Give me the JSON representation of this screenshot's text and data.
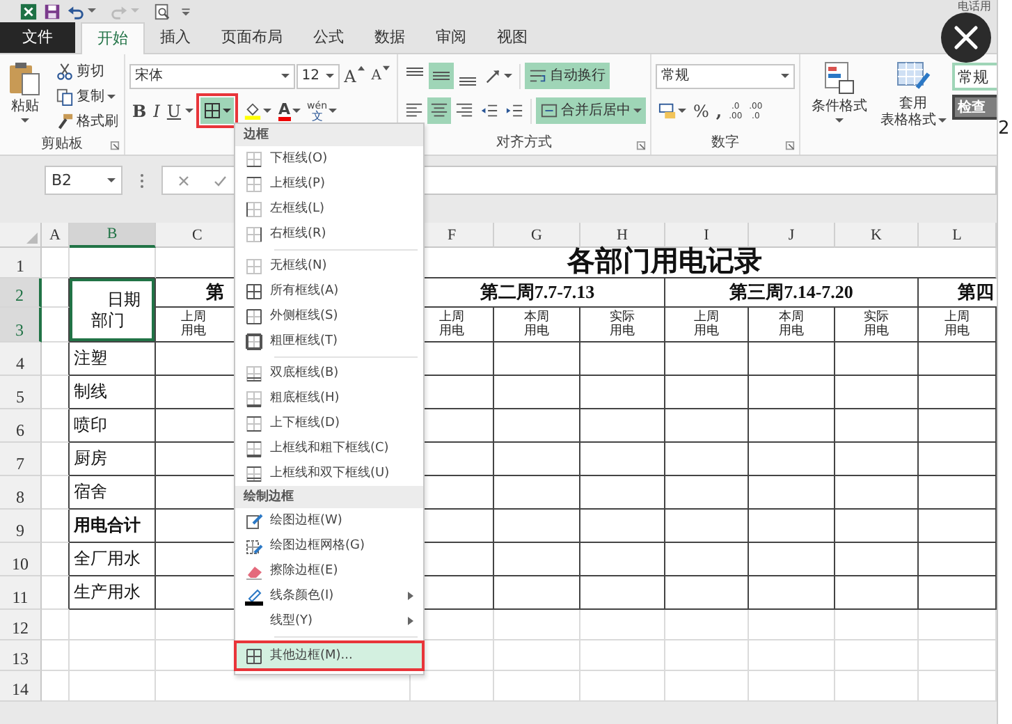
{
  "title_bar": {
    "text": "电话用"
  },
  "tabs": [
    {
      "label": "文件",
      "kind": "file",
      "selected": false
    },
    {
      "label": "开始",
      "kind": "tab",
      "selected": true
    },
    {
      "label": "插入",
      "kind": "tab",
      "selected": false
    },
    {
      "label": "页面布局",
      "kind": "tab",
      "selected": false
    },
    {
      "label": "公式",
      "kind": "tab",
      "selected": false
    },
    {
      "label": "数据",
      "kind": "tab",
      "selected": false
    },
    {
      "label": "审阅",
      "kind": "tab",
      "selected": false
    },
    {
      "label": "视图",
      "kind": "tab",
      "selected": false
    }
  ],
  "ribbon": {
    "clipboard": {
      "label": "剪贴板",
      "paste": "粘贴",
      "cut": "剪切",
      "copy": "复制",
      "format_painter": "格式刷"
    },
    "font": {
      "name": "宋体",
      "size": "12",
      "grow": "A",
      "shrink": "A",
      "bold": "B",
      "italic": "I",
      "underline": "U",
      "font_color": "A",
      "phonetic": [
        "wén",
        "文"
      ],
      "borders_annotated": true
    },
    "alignment": {
      "label": "对齐方式",
      "align_buttons": [
        {
          "selected": false
        },
        {
          "selected": true
        },
        {
          "selected": false
        },
        {
          "selected": false
        },
        {
          "selected": true
        },
        {
          "selected": false
        }
      ],
      "wrap_text": {
        "label": "自动换行",
        "on": true
      },
      "merge_center": {
        "label": "合并后居中",
        "on": true
      }
    },
    "number": {
      "label": "数字",
      "format": "常规",
      "percent": "%",
      "comma": ",",
      "increase_decimal": [
        ".0",
        ".00"
      ],
      "decrease_decimal": [
        ".00",
        ".0"
      ]
    },
    "styles": {
      "conditional": "条件格式",
      "table_format": [
        "套用",
        "表格格式"
      ],
      "cell_styles": [
        {
          "label": "常规",
          "kind": "normal"
        },
        {
          "label": "检查",
          "kind": "check"
        }
      ]
    }
  },
  "formula_bar": {
    "name_box": "B2"
  },
  "sheet": {
    "columns": [
      {
        "label": "A",
        "selected": false
      },
      {
        "label": "B",
        "selected": true
      },
      {
        "label": "C",
        "selected": false
      },
      {
        "label": "F",
        "selected": false
      },
      {
        "label": "G",
        "selected": false
      },
      {
        "label": "H",
        "selected": false
      },
      {
        "label": "I",
        "selected": false
      },
      {
        "label": "J",
        "selected": false
      },
      {
        "label": "K",
        "selected": false
      },
      {
        "label": "L",
        "selected": false
      }
    ],
    "rows": [
      {
        "label": "1",
        "selected": false
      },
      {
        "label": "2",
        "selected": true
      },
      {
        "label": "3",
        "selected": true
      },
      {
        "label": "4",
        "selected": false
      },
      {
        "label": "5",
        "selected": false
      },
      {
        "label": "6",
        "selected": false
      },
      {
        "label": "7",
        "selected": false
      },
      {
        "label": "8",
        "selected": false
      },
      {
        "label": "9",
        "selected": false
      },
      {
        "label": "10",
        "selected": false
      },
      {
        "label": "11",
        "selected": false
      },
      {
        "label": "12",
        "selected": false
      },
      {
        "label": "13",
        "selected": false
      },
      {
        "label": "14",
        "selected": false
      }
    ],
    "title": "各部门用电记录",
    "corner_header": {
      "top": "日期",
      "bottom": "部门",
      "selected": true
    },
    "week_headers": [
      "第",
      "第二周7.7-7.13",
      "第三周7.14-7.20",
      "第四"
    ],
    "sub_headers": [
      "上周用电",
      "上周用电",
      "本周用电",
      "实际用电",
      "上周用电",
      "本周用电",
      "实际用电",
      "上周用电"
    ],
    "departments": [
      {
        "label": "注塑",
        "bold": false
      },
      {
        "label": "制线",
        "bold": false
      },
      {
        "label": "喷印",
        "bold": false
      },
      {
        "label": "厨房",
        "bold": false
      },
      {
        "label": "宿舍",
        "bold": false
      },
      {
        "label": "用电合计",
        "bold": true
      },
      {
        "label": "全厂用水",
        "bold": false
      },
      {
        "label": "生产用水",
        "bold": false
      }
    ]
  },
  "menu": {
    "sections": [
      {
        "header": "边框",
        "groups": [
          [
            {
              "label": "下框线(O)",
              "submenu": false,
              "selected": false,
              "annotated": false
            },
            {
              "label": "上框线(P)",
              "submenu": false,
              "selected": false,
              "annotated": false
            },
            {
              "label": "左框线(L)",
              "submenu": false,
              "selected": false,
              "annotated": false
            },
            {
              "label": "右框线(R)",
              "submenu": false,
              "selected": false,
              "annotated": false
            }
          ],
          [
            {
              "label": "无框线(N)",
              "submenu": false,
              "selected": false,
              "annotated": false
            },
            {
              "label": "所有框线(A)",
              "submenu": false,
              "selected": false,
              "annotated": false
            },
            {
              "label": "外侧框线(S)",
              "submenu": false,
              "selected": false,
              "annotated": false
            },
            {
              "label": "粗匣框线(T)",
              "submenu": false,
              "selected": false,
              "annotated": false
            }
          ],
          [
            {
              "label": "双底框线(B)",
              "submenu": false,
              "selected": false,
              "annotated": false
            },
            {
              "label": "粗底框线(H)",
              "submenu": false,
              "selected": false,
              "annotated": false
            },
            {
              "label": "上下框线(D)",
              "submenu": false,
              "selected": false,
              "annotated": false
            },
            {
              "label": "上框线和粗下框线(C)",
              "submenu": false,
              "selected": false,
              "annotated": false
            },
            {
              "label": "上框线和双下框线(U)",
              "submenu": false,
              "selected": false,
              "annotated": false
            }
          ]
        ]
      },
      {
        "header": "绘制边框",
        "groups": [
          [
            {
              "label": "绘图边框(W)",
              "submenu": false,
              "selected": false,
              "annotated": false
            },
            {
              "label": "绘图边框网格(G)",
              "submenu": false,
              "selected": false,
              "annotated": false
            },
            {
              "label": "擦除边框(E)",
              "submenu": false,
              "selected": false,
              "annotated": false
            },
            {
              "label": "线条颜色(I)",
              "submenu": true,
              "selected": false,
              "annotated": false
            },
            {
              "label": "线型(Y)",
              "submenu": true,
              "selected": false,
              "annotated": false
            }
          ],
          [
            {
              "label": "其他边框(M)...",
              "submenu": false,
              "selected": true,
              "annotated": true
            }
          ]
        ]
      }
    ]
  },
  "edge_text": "2"
}
